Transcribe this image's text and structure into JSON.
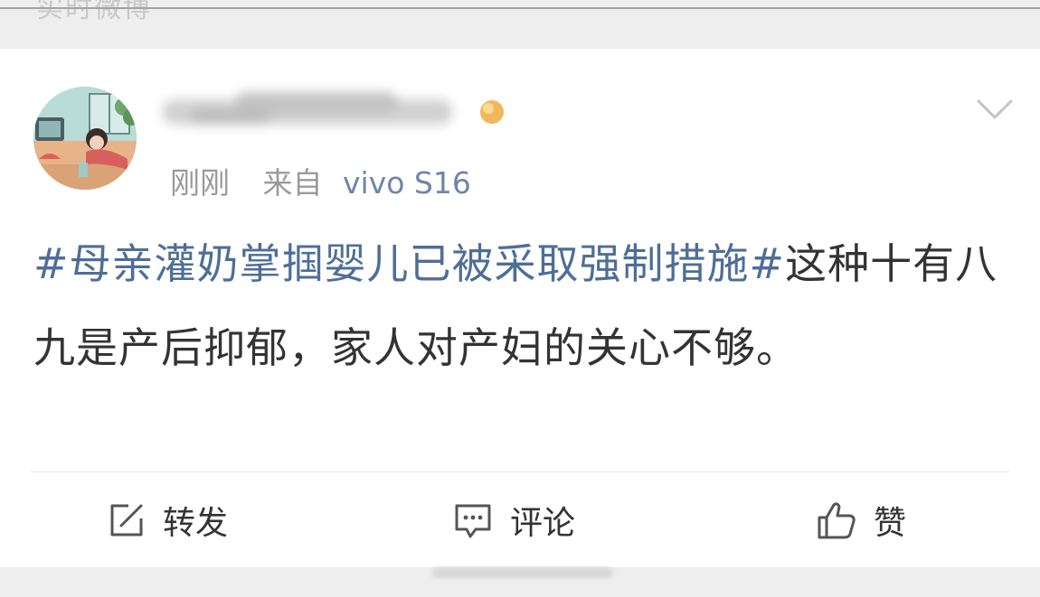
{
  "header": {
    "partial_text": "实时微博"
  },
  "post": {
    "timestamp": "刚刚",
    "source_prefix": "来自",
    "device": "vivo S16",
    "hashtag": "#母亲灌奶掌掴婴儿已被采取强制措施#",
    "body": "这种十有八九是产后抑郁，家人对产妇的关心不够。",
    "menu_icon": "chevron-down-icon"
  },
  "actions": {
    "repost_label": "转发",
    "comment_label": "评论",
    "like_label": "赞"
  },
  "colors": {
    "link": "#4e6e97",
    "meta": "#9a9a9a",
    "text": "#333333"
  }
}
